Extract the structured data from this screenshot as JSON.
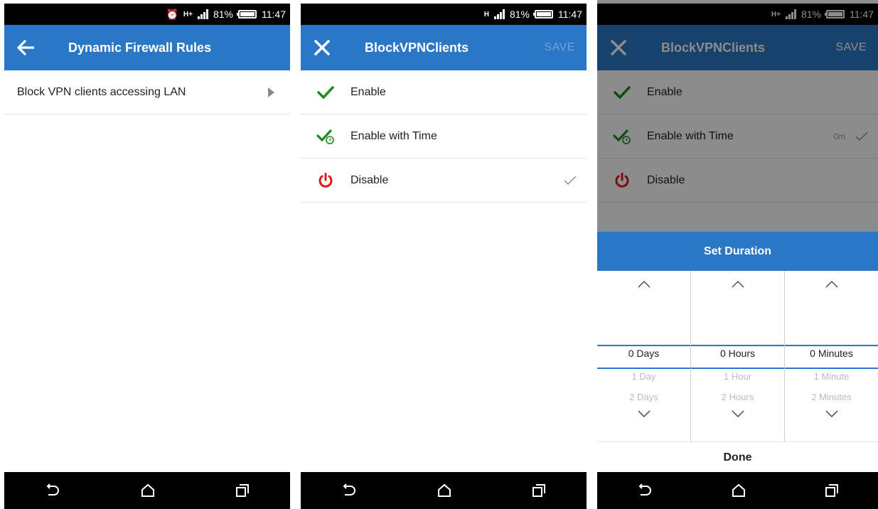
{
  "status": {
    "s1": {
      "network": "H+",
      "battery": "81%",
      "time": "11:47"
    },
    "s2": {
      "network": "H",
      "battery": "81%",
      "time": "11:47"
    },
    "s3": {
      "network": "H+",
      "battery": "81%",
      "time": "11:47"
    }
  },
  "screen1": {
    "title": "Dynamic Firewall Rules",
    "items": [
      {
        "label": "Block VPN clients accessing LAN"
      }
    ]
  },
  "screen2": {
    "title": "BlockVPNClients",
    "save_label": "SAVE",
    "options": [
      {
        "label": "Enable"
      },
      {
        "label": "Enable with Time"
      },
      {
        "label": "Disable"
      }
    ]
  },
  "screen3": {
    "title": "BlockVPNClients",
    "save_label": "SAVE",
    "options": [
      {
        "label": "Enable"
      },
      {
        "label": "Enable with Time",
        "value": "0m"
      },
      {
        "label": "Disable"
      }
    ],
    "sheet": {
      "title": "Set Duration",
      "done_label": "Done",
      "columns": [
        {
          "selected": "0 Days",
          "next1": "1 Day",
          "next2": "2 Days"
        },
        {
          "selected": "0 Hours",
          "next1": "1 Hour",
          "next2": "2 Hours"
        },
        {
          "selected": "0 Minutes",
          "next1": "1 Minute",
          "next2": "2 Minutes"
        }
      ]
    }
  },
  "colors": {
    "accent": "#2a78c5",
    "enable": "#1e8a1e",
    "disable": "#e01818"
  }
}
